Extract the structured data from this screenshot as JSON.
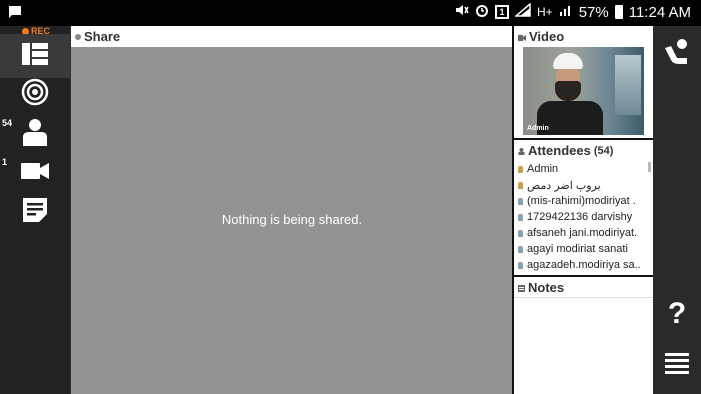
{
  "status_bar": {
    "time": "11:24 AM",
    "battery": "57%",
    "sim_label": "1",
    "network_label": "H+",
    "icons": [
      "chat-notification-icon",
      "mute-icon",
      "alarm-icon",
      "sim-icon",
      "signal-icon",
      "battery-icon"
    ]
  },
  "left_bar": {
    "rec_label": "REC",
    "items": [
      {
        "name": "layout",
        "icon": "layout-icon"
      },
      {
        "name": "broadcast",
        "icon": "target-icon"
      },
      {
        "name": "attendees",
        "icon": "person-icon",
        "count": "54"
      },
      {
        "name": "video",
        "icon": "camera-icon",
        "count": "1"
      },
      {
        "name": "notes",
        "icon": "notes-icon"
      }
    ]
  },
  "share": {
    "title": "Share",
    "message": "Nothing is being shared."
  },
  "video": {
    "title": "Video",
    "participant_label": "Admin"
  },
  "attendees": {
    "title": "Attendees",
    "count": "(54)",
    "list": [
      {
        "name": "Admin",
        "role": "host"
      },
      {
        "name": "یروپ اضر دمص",
        "role": "host"
      },
      {
        "name": "(mis-rahimi)modiriyat .",
        "role": "user"
      },
      {
        "name": "1729422136 darvishy",
        "role": "user"
      },
      {
        "name": "afsaneh jani.modiriyat.",
        "role": "user"
      },
      {
        "name": "agayi modiriat sanati",
        "role": "user"
      },
      {
        "name": "agazadeh.modiriya sa..",
        "role": "user"
      }
    ]
  },
  "notes": {
    "title": "Notes"
  },
  "right_bar": {
    "help_label": "?",
    "items": [
      "raise-hand-icon",
      "help-icon",
      "menu-icon"
    ]
  },
  "colors": {
    "rec": "#f47a20",
    "share_bg": "#939393",
    "sidebar_bg": "#222222"
  }
}
